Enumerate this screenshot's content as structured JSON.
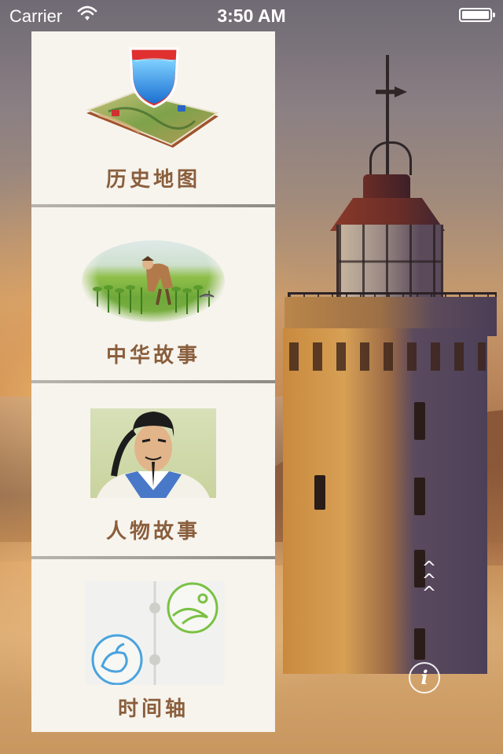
{
  "status_bar": {
    "carrier": "Carrier",
    "time": "3:50 AM"
  },
  "menu": {
    "items": [
      {
        "label": "历史地图",
        "icon": "map-icon"
      },
      {
        "label": "中华故事",
        "icon": "farmer-illustration"
      },
      {
        "label": "人物故事",
        "icon": "portrait-illustration"
      },
      {
        "label": "时间轴",
        "icon": "timeline-icon"
      }
    ]
  },
  "scroll_hint": "^^^",
  "info_button": "i",
  "colors": {
    "menu_background": "#f7f4ee",
    "label_color": "#8a5e3c",
    "timeline_green": "#7ac143",
    "timeline_blue": "#4aa3df"
  }
}
